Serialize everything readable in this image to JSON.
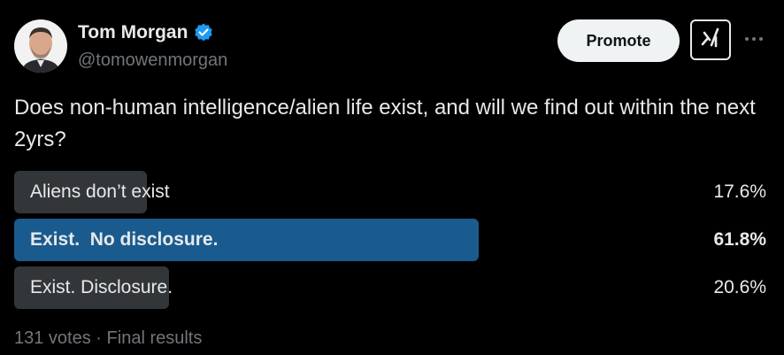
{
  "author": {
    "name": "Tom Morgan",
    "handle": "@tomowenmorgan",
    "verified": true
  },
  "header": {
    "promote_label": "Promote",
    "grok_icon": "grok-icon",
    "more_icon": "more-icon"
  },
  "tweet": {
    "text": "Does non-human intelligence/alien life exist, and will we find out within the next 2yrs?"
  },
  "poll": {
    "options": [
      {
        "label": "Aliens don’t exist",
        "percent_label": "17.6%",
        "percent": 17.6,
        "winner": false
      },
      {
        "label": "Exist.  No disclosure.",
        "percent_label": "61.8%",
        "percent": 61.8,
        "winner": true
      },
      {
        "label": "Exist. Disclosure.",
        "percent_label": "20.6%",
        "percent": 20.6,
        "winner": false
      }
    ],
    "votes": "131 votes",
    "separator": "·",
    "status": "Final results"
  },
  "colors": {
    "background": "#000000",
    "text": "#e7e9ea",
    "muted": "#71767b",
    "verified": "#1d9bf0",
    "bar": "#333639",
    "winner_bar": "#1a5b8f"
  }
}
